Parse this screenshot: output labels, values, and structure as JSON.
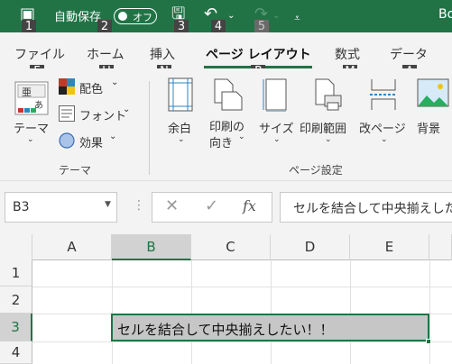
{
  "titlebar": {
    "autosave_label": "自動保存",
    "autosave_state": "オフ",
    "title_partial": "Bo",
    "keytips": [
      "1",
      "2",
      "3",
      "4",
      "5"
    ]
  },
  "tabs": [
    {
      "label": "ファイル",
      "keytip": "F"
    },
    {
      "label": "ホーム",
      "keytip": "H"
    },
    {
      "label": "挿入",
      "keytip": "N"
    },
    {
      "label": "ページ レイアウト",
      "keytip": "P",
      "active": true
    },
    {
      "label": "数式",
      "keytip": "M"
    },
    {
      "label": "データ",
      "keytip": "A"
    }
  ],
  "ribbon": {
    "themes": {
      "theme_label": "テーマ",
      "colors_label": "配色",
      "fonts_label": "フォント",
      "effects_label": "効果",
      "group_label": "テーマ"
    },
    "page_setup": {
      "margins_label": "余白",
      "orientation_line1": "印刷の",
      "orientation_line2": "向き",
      "size_label": "サイズ",
      "print_area_label": "印刷範囲",
      "breaks_label": "改ページ",
      "background_label": "背景",
      "group_label": "ページ設定"
    }
  },
  "formula_bar": {
    "name_box": "B3",
    "formula": "セルを結合して中央揃えしたい！！"
  },
  "grid": {
    "columns": [
      "A",
      "B",
      "C",
      "D",
      "E"
    ],
    "rows": [
      "1",
      "2",
      "3",
      "4"
    ],
    "selected_column": "B",
    "selected_row": "3",
    "merged_cell_text": "セルを結合して中央揃えしたい！！"
  },
  "colors": {
    "excel_green": "#217346",
    "keytip_bg": "#444444",
    "selected_cell_fill": "#c6c6c6"
  }
}
